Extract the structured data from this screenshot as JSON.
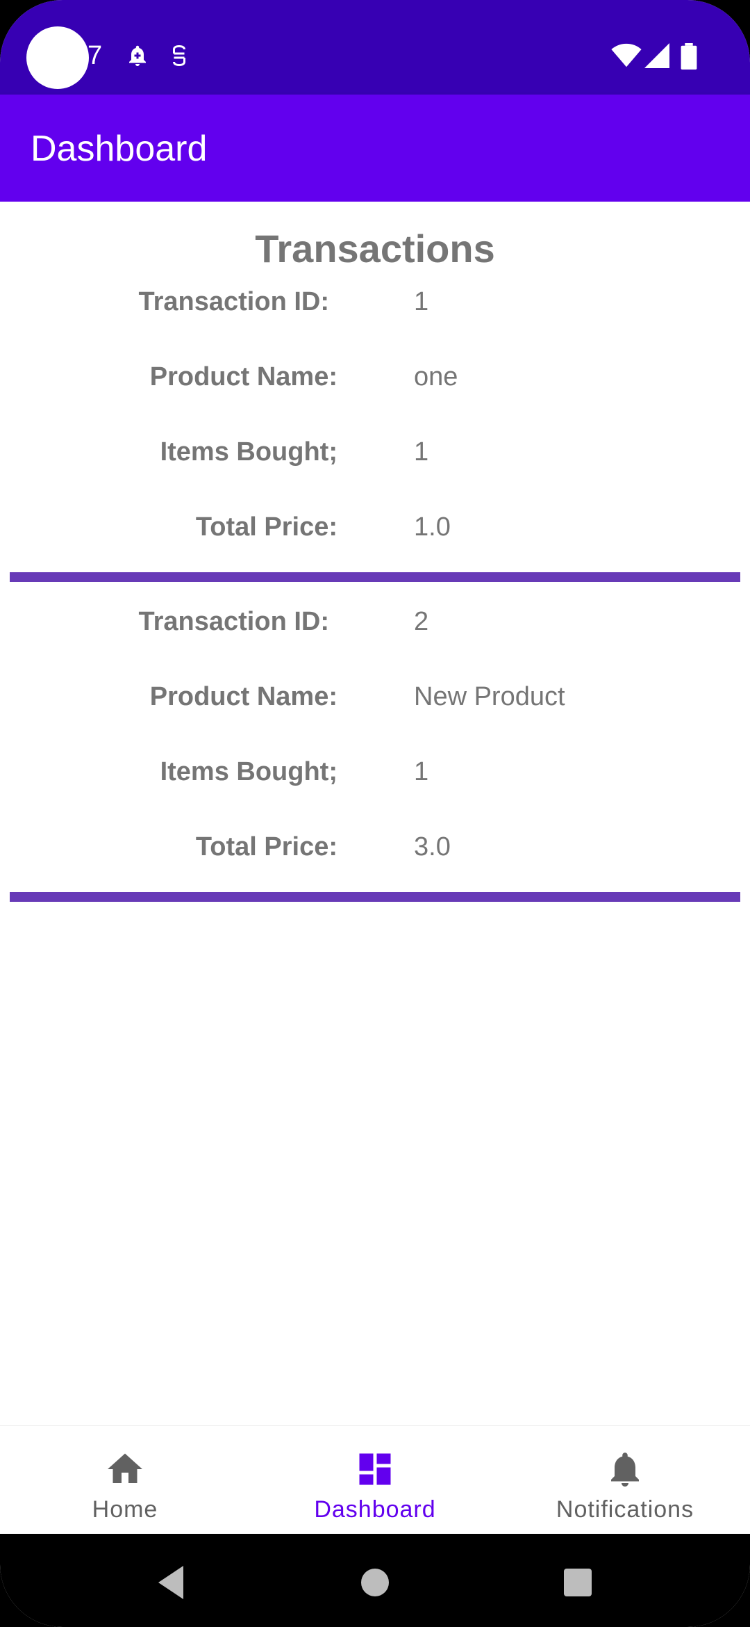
{
  "status_bar": {
    "time": "7",
    "icons_left": [
      "notification-add-icon",
      "sim-icon"
    ],
    "icons_right": [
      "wifi-icon",
      "signal-icon",
      "battery-icon"
    ]
  },
  "app_bar": {
    "title": "Dashboard"
  },
  "content": {
    "section_title": "Transactions",
    "transactions": [
      {
        "id_label": "Transaction ID:",
        "id_value": "1",
        "product_label": "Product Name:",
        "product_value": "one",
        "items_label": "Items Bought;",
        "items_value": "1",
        "price_label": "Total Price:",
        "price_value": "1.0"
      },
      {
        "id_label": "Transaction ID:",
        "id_value": "2",
        "product_label": "Product Name:",
        "product_value": "New Product",
        "items_label": "Items Bought;",
        "items_value": "1",
        "price_label": "Total Price:",
        "price_value": "3.0"
      }
    ]
  },
  "bottom_nav": {
    "items": [
      {
        "label": "Home",
        "icon": "home-icon",
        "active": false
      },
      {
        "label": "Dashboard",
        "icon": "dashboard-icon",
        "active": true
      },
      {
        "label": "Notifications",
        "icon": "bell-icon",
        "active": false
      }
    ]
  },
  "system_nav": {
    "buttons": [
      "back-icon",
      "home-circle-icon",
      "recents-icon"
    ]
  },
  "colors": {
    "status_bar": "#3700B3",
    "primary": "#6200EE",
    "divider": "#673AB7",
    "text_gray": "#757575",
    "nav_inactive": "#616161"
  }
}
